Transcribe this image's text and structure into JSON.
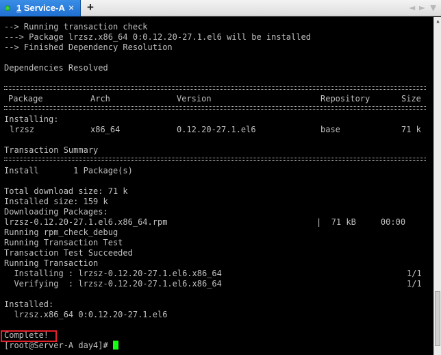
{
  "tab": {
    "number": "1",
    "title": "Service-A",
    "close": "×"
  },
  "new_tab": "+",
  "nav": {
    "back": "◄",
    "forward": "►",
    "menu": "▼"
  },
  "lines": {
    "l1": "--> Running transaction check",
    "l2": "---> Package lrzsz.x86_64 0:0.12.20-27.1.el6 will be installed",
    "l3": "--> Finished Dependency Resolution",
    "l4": "Dependencies Resolved",
    "installing": "Installing:",
    "summary": "Transaction Summary",
    "install_count": "Install       1 Package(s)",
    "dl_size": "Total download size: 71 k",
    "inst_size": "Installed size: 159 k",
    "downloading": "Downloading Packages:",
    "rpm_file": "lrzsz-0.12.20-27.1.el6.x86_64.rpm",
    "rpm_progress": "|  71 kB     00:00",
    "rpm_check": "Running rpm_check_debug",
    "trans_test": "Running Transaction Test",
    "trans_ok": "Transaction Test Succeeded",
    "running": "Running Transaction",
    "installing_step": "  Installing : lrzsz-0.12.20-27.1.el6.x86_64",
    "installing_count": "1/1",
    "verifying_step": "  Verifying  : lrzsz-0.12.20-27.1.el6.x86_64",
    "verifying_count": "1/1",
    "installed_hdr": "Installed:",
    "installed_pkg": "  lrzsz.x86_64 0:0.12.20-27.1.el6",
    "complete": "Complete!",
    "prompt": "[root@Server-A day4]# "
  },
  "table": {
    "headers": {
      "package": "Package",
      "arch": "Arch",
      "version": "Version",
      "repository": "Repository",
      "size": "Size"
    },
    "row": {
      "package": "lrzsz",
      "arch": "x86_64",
      "version": "0.12.20-27.1.el6",
      "repository": "base",
      "size": "71 k"
    }
  },
  "colors": {
    "background": "#000000",
    "text": "#c0c0c0",
    "cursor": "#14ff14",
    "highlight": "#e8202a",
    "tab_active": "#2a7fe0"
  }
}
